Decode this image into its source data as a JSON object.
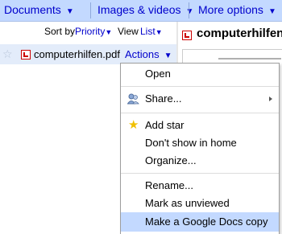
{
  "topbar": {
    "documents_label": "Documents",
    "images_label": "Images & videos",
    "more_label": "More options",
    "arrow": "▼"
  },
  "sortbar": {
    "sort_by_label": "Sort by",
    "sort_value": "Priority",
    "view_label": "View",
    "view_value": "List",
    "arrow": "▼"
  },
  "file": {
    "name": "computerhilfen.pdf",
    "actions_label": "Actions",
    "arrow": "▼"
  },
  "preview": {
    "title": "computerhilfen"
  },
  "menu": {
    "items": [
      {
        "label": "Open"
      },
      {
        "label": "Share..."
      },
      {
        "label": "Add star"
      },
      {
        "label": "Don't show in home"
      },
      {
        "label": "Organize..."
      },
      {
        "label": "Rename..."
      },
      {
        "label": "Mark as unviewed"
      },
      {
        "label": "Make a Google Docs copy"
      }
    ],
    "highlight_color": "#c3d9ff"
  },
  "colors": {
    "topbar": "#c3d9ff",
    "link": "#0000cc",
    "selected_row": "#e3ecfa",
    "pdf_red": "#cc0000"
  },
  "icons": [
    "star-empty-icon",
    "pdf-icon",
    "share-people-icon",
    "star-icon",
    "submenu-arrow-icon"
  ]
}
